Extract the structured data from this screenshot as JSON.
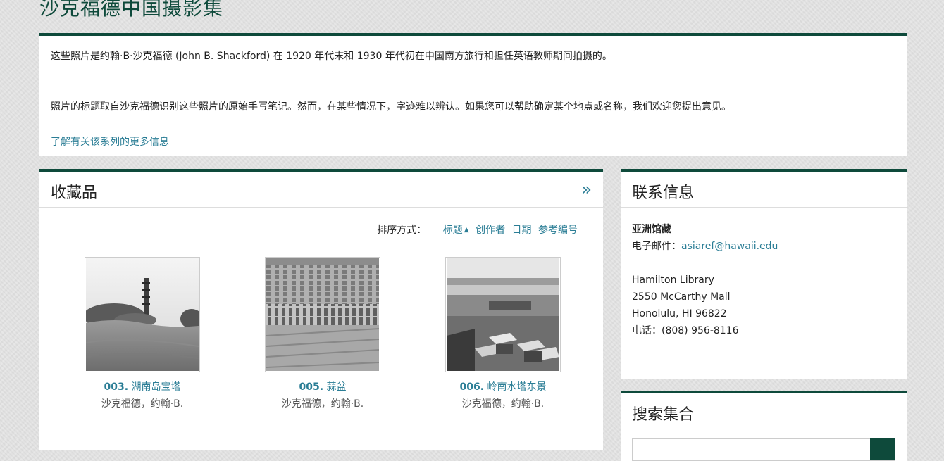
{
  "site": {
    "title": "沙克福德中国摄影集"
  },
  "intro": {
    "paragraph1": "这些照片是约翰·B·沙克福德 (John B. Shackford) 在 1920 年代末和 1930 年代初在中国南方旅行和担任英语教师期间拍摄的。",
    "paragraph2": "照片的标题取自沙克福德识别这些照片的原始手写笔记。然而，在某些情况下，字迹难以辨认。如果您可以帮助确定某个地点或名称，我们欢迎您提出意见。",
    "more_link": "了解有关该系列的更多信息"
  },
  "collection": {
    "title": "收藏品",
    "expand_icon": "»",
    "sort": {
      "label": "排序方式：",
      "options": [
        {
          "label": "标题",
          "active": true,
          "arrow": "▲"
        },
        {
          "label": "创作者"
        },
        {
          "label": "日期"
        },
        {
          "label": "参考编号"
        }
      ]
    },
    "items": [
      {
        "number": "003.",
        "title": "湖南岛宝塔",
        "creator": "沙克福德，约翰·B.",
        "thumb_icon": "pagoda-photo-icon"
      },
      {
        "number": "005.",
        "title": "蒜盆",
        "creator": "沙克福德，约翰·B.",
        "thumb_icon": "field-photo-icon"
      },
      {
        "number": "006.",
        "title": "岭南水塔东景",
        "creator": "沙克福德，约翰·B.",
        "thumb_icon": "village-photo-icon"
      }
    ]
  },
  "contact": {
    "title": "联系信息",
    "name": "亚洲馆藏",
    "email_label": "电子邮件：",
    "email": "asiaref@hawaii.edu",
    "address": [
      "Hamilton Library",
      "2550 McCarthy Mall",
      "Honolulu, HI 96822"
    ],
    "phone": "电话：(808) 956-8116"
  },
  "search": {
    "title": "搜索集合"
  },
  "colors": {
    "accent": "#0e4a3b",
    "link": "#2a7d95",
    "background": "#e3e3e3"
  }
}
